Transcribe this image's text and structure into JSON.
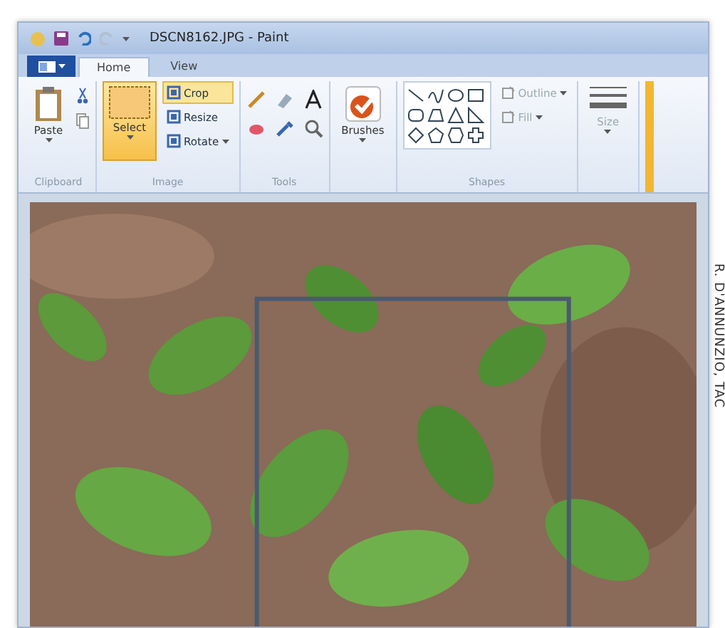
{
  "window": {
    "title": "DSCN8162.JPG - Paint"
  },
  "tabs": [
    {
      "label": "Home",
      "selected": true
    },
    {
      "label": "View",
      "selected": false
    }
  ],
  "ribbon": {
    "groups": [
      {
        "kind": "clipboard",
        "label": "Clipboard",
        "items": [
          {
            "kind": "large",
            "label": "Paste",
            "highlighted": false,
            "disabled": false
          }
        ]
      },
      {
        "label": "Image",
        "items": [
          {
            "kind": "large",
            "label": "Select",
            "highlighted": true,
            "disabled": false
          },
          {
            "kind": "small",
            "label": "Crop",
            "highlighted": true,
            "disabled": false
          },
          {
            "kind": "small",
            "label": "Resize",
            "highlighted": false,
            "disabled": false
          },
          {
            "kind": "small",
            "label": "Rotate",
            "highlighted": false,
            "disabled": false
          }
        ]
      },
      {
        "kind": "tools",
        "label": "Tools"
      },
      {
        "kind": "brushes",
        "items": [
          {
            "kind": "large",
            "label": "Brushes",
            "highlighted": false,
            "disabled": false
          }
        ]
      },
      {
        "kind": "shapes",
        "label": "Shapes",
        "items": [
          {
            "kind": "small",
            "label": "Outline",
            "highlighted": false,
            "disabled": true
          },
          {
            "kind": "small",
            "label": "Fill",
            "highlighted": false,
            "disabled": true
          }
        ]
      },
      {
        "kind": "size",
        "items": [
          {
            "kind": "large",
            "label": "Size",
            "highlighted": false,
            "disabled": true
          }
        ]
      }
    ]
  },
  "credit": "R. D'ANNUNZIO, TAC"
}
